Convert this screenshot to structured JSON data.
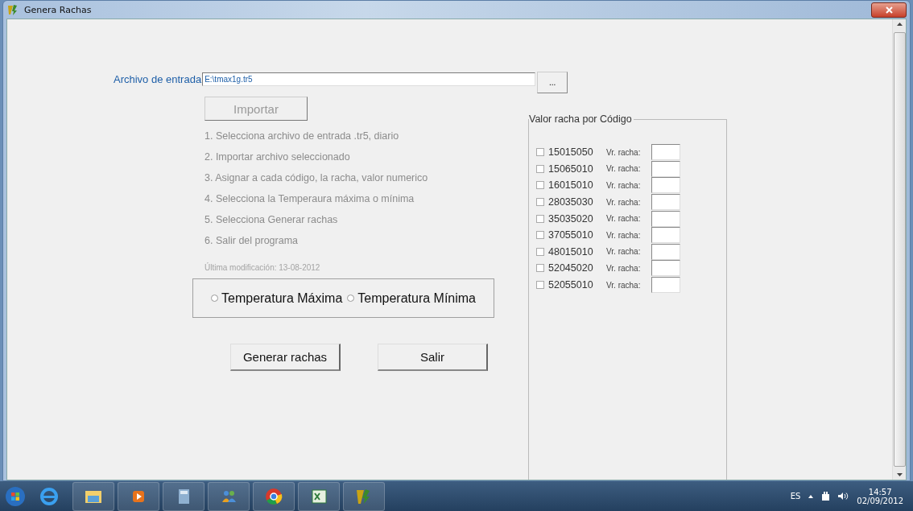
{
  "window": {
    "title": "Genera Rachas"
  },
  "input_file": {
    "label": "Archivo de entrada",
    "value": "E:\\tmax1g.tr5",
    "browse_button": "..."
  },
  "import_button": {
    "label": "Importar",
    "disabled": true
  },
  "steps": [
    "1. Selecciona archivo de entrada .tr5, diario",
    "2. Importar archivo seleccionado",
    "3. Asignar a cada código, la racha, valor numerico",
    "4. Selecciona la Temperaura máxima o mínima",
    "5. Selecciona Generar rachas",
    "6. Salir del programa"
  ],
  "last_modified": "Última modificación: 13-08-2012",
  "temperature_options": [
    {
      "label": "Temperatura Máxima",
      "selected": false
    },
    {
      "label": "Temperatura Mínima",
      "selected": false
    }
  ],
  "buttons": [
    "Generar rachas",
    "Salir"
  ],
  "codes_group": {
    "title": "Valor racha por Código",
    "rows": [
      {
        "code": "15015050",
        "checked": false,
        "label": "Vr. racha:"
      },
      {
        "code": "15065010",
        "checked": false,
        "label": "Vr. racha:"
      },
      {
        "code": "16015010",
        "checked": false,
        "label": "Vr. racha:"
      },
      {
        "code": "28035030",
        "checked": false,
        "label": "Vr. racha:"
      },
      {
        "code": "35035020",
        "checked": false,
        "label": "Vr. racha:"
      },
      {
        "code": "37055010",
        "checked": false,
        "label": "Vr. racha:"
      },
      {
        "code": "48015010",
        "checked": false,
        "label": "Vr. racha:"
      },
      {
        "code": "52045020",
        "checked": false,
        "label": "Vr. racha:"
      },
      {
        "code": "52055010",
        "checked": false,
        "label": "Vr. racha:"
      }
    ]
  },
  "taskbar": {
    "language": "ES",
    "time": "14:57",
    "date": "02/09/2012"
  }
}
